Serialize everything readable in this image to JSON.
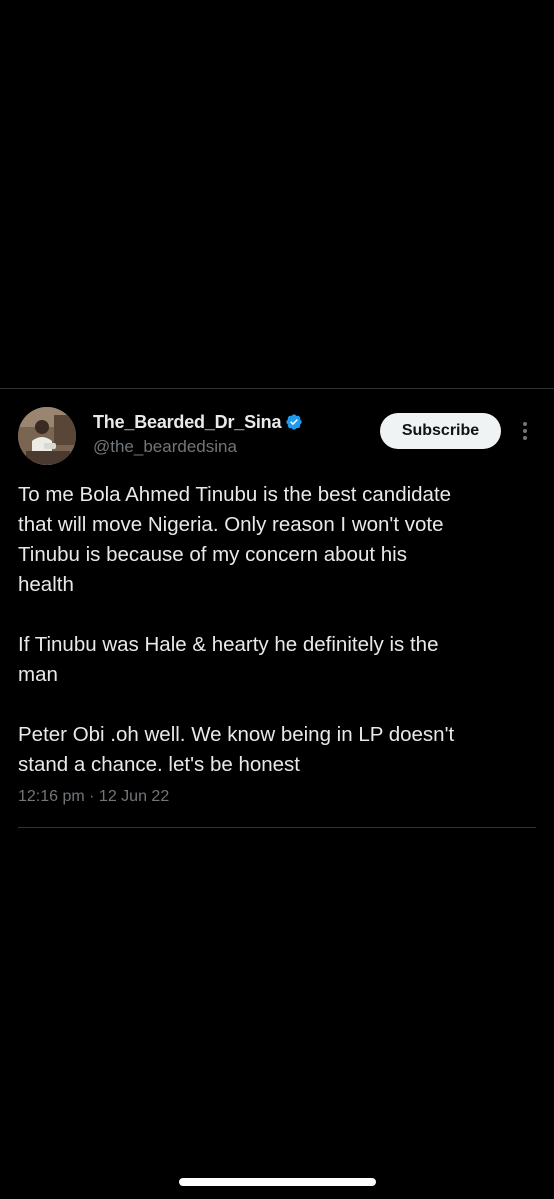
{
  "tweet": {
    "author": {
      "display_name": "The_Bearded_Dr_Sina",
      "handle": "@the_beardedsina",
      "verified": true,
      "verified_icon": "verified-badge-icon",
      "avatar_icon": "profile-avatar"
    },
    "subscribe_label": "Subscribe",
    "more_icon": "more-options-icon",
    "paragraphs": [
      "To me Bola Ahmed Tinubu is the best candidate\nthat will move Nigeria. Only reason I won't vote\nTinubu is because of my concern about his\nhealth",
      "If Tinubu was Hale & hearty he definitely is the\nman",
      "Peter Obi .oh well. We know being in LP doesn't\nstand a chance. let's be honest"
    ],
    "timestamp": "12:16 pm · 12 Jun 22"
  },
  "colors": {
    "background": "#000000",
    "text_primary": "#e7e9ea",
    "text_secondary": "#71767b",
    "verified_blue": "#1d9bf0",
    "divider": "#2f3336",
    "button_bg": "#eff3f4"
  }
}
